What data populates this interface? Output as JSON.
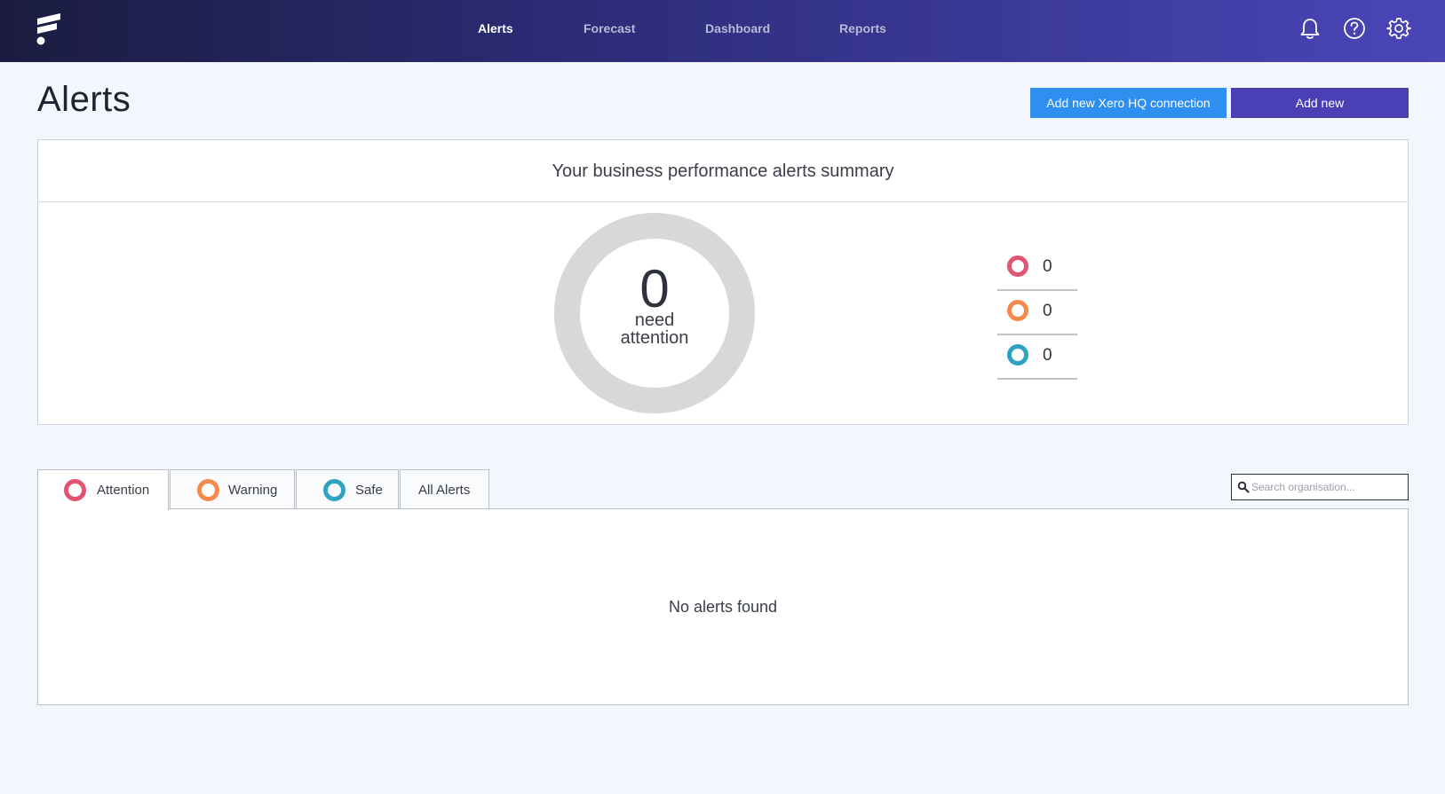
{
  "nav": {
    "items": [
      {
        "label": "Alerts",
        "active": true
      },
      {
        "label": "Forecast",
        "active": false
      },
      {
        "label": "Dashboard",
        "active": false
      },
      {
        "label": "Reports",
        "active": false
      }
    ],
    "icons": [
      "bell-icon",
      "help-icon",
      "gear-icon"
    ]
  },
  "page": {
    "title": "Alerts"
  },
  "actions": {
    "xero_label": "Add new Xero HQ connection",
    "add_label": "Add new"
  },
  "summary": {
    "heading": "Your business performance alerts summary",
    "total": "0",
    "total_label_line1": "need",
    "total_label_line2": "attention",
    "legend": [
      {
        "status": "attention",
        "count": "0",
        "color": "#e0556f"
      },
      {
        "status": "warning",
        "count": "0",
        "color": "#f58a4b"
      },
      {
        "status": "safe",
        "count": "0",
        "color": "#2fa3c2"
      }
    ]
  },
  "tabs": [
    {
      "label": "Attention",
      "color": "#e0556f",
      "active": true
    },
    {
      "label": "Warning",
      "color": "#f58a4b",
      "active": false
    },
    {
      "label": "Safe",
      "color": "#2fa3c2",
      "active": false
    },
    {
      "label": "All Alerts",
      "active": false
    }
  ],
  "search": {
    "placeholder": "Search organisation..."
  },
  "alerts": {
    "empty_message": "No alerts found"
  }
}
